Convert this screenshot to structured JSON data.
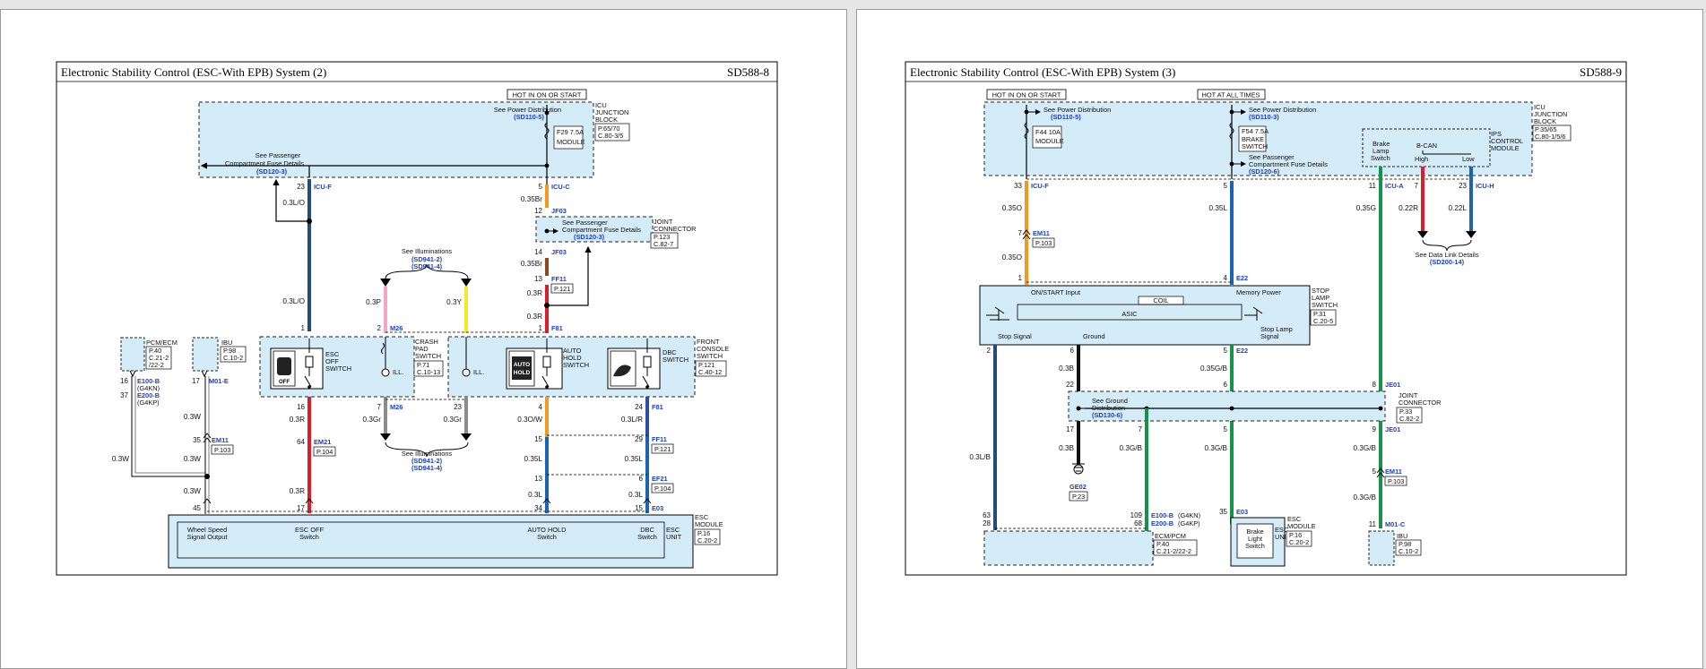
{
  "colors": {
    "box_fill": "#d4ebf8",
    "orange": "#f19a1f",
    "blue": "#1d64b0",
    "red": "#d81e2a",
    "pink": "#f2a7c5",
    "yellow": "#f4e82a",
    "gray": "#8c8c8c",
    "green": "#16924a",
    "dark_blue": "#214d7a",
    "black": "#000000",
    "link_blue": "#1a3ed0"
  },
  "left": {
    "title": "Electronic Stability Control (ESC-With EPB) System (2)",
    "code": "SD588-8",
    "hot": "HOT IN ON OR START",
    "spd": "See Power Distribution",
    "spd_ref": "(SD110-5)",
    "fuse": [
      "F29 7.5A",
      "MODULE"
    ],
    "icu": [
      "ICU",
      "JUNCTION",
      "BLOCK"
    ],
    "icu_ref": [
      "P.65/70",
      "C.80-3/5"
    ],
    "spc": [
      "See Passenger",
      "Compartment Fuse Details"
    ],
    "spc_ref": "(SD120-3)",
    "icu_f": {
      "pin": "23",
      "name": "ICU-F",
      "wire": "0.3L/O"
    },
    "icu_c": {
      "pin": "5",
      "name": "ICU-C",
      "wire": "0.35Br"
    },
    "jf03": {
      "pin1": "12",
      "name": "JF03",
      "pin2": "14",
      "name2": "JF03",
      "wire2": "0.35Br"
    },
    "joint_conn": [
      "JOINT",
      "CONNECTOR"
    ],
    "joint_ref": [
      "P.123",
      "C.82-7"
    ],
    "ff11a": {
      "pin": "13",
      "name": "FF11",
      "ref": "P.121"
    },
    "wire_03r": "0.3R",
    "f81a": {
      "pin": "1",
      "name": "F81"
    },
    "see_illum": "See Illuminations",
    "illum_refs": [
      "(SD941-2)",
      "(SD941-4)"
    ],
    "w_03p": "0.3P",
    "w_03y": "0.3Y",
    "m26a": {
      "pin": "2",
      "name": "M26"
    },
    "crash_pad": [
      "CRASH",
      "PAD",
      "SWITCH"
    ],
    "crash_ref": [
      "P.71",
      "C.10-13"
    ],
    "esc_off_sw": [
      "ESC",
      "OFF",
      "SWITCH"
    ],
    "auto_hold_sw": [
      "AUTO",
      "HOLD",
      "SWITCH"
    ],
    "dbc_sw": [
      "DBC",
      "SWITCH"
    ],
    "front_console": [
      "FRONT",
      "CONSOLE",
      "SWITCH"
    ],
    "front_ref": [
      "P.121",
      "C.40-12"
    ],
    "ill": "ILL.",
    "off_icon": "OFF",
    "auto_hold_icon": [
      "AUTO",
      "HOLD"
    ],
    "pin_1": "1",
    "pin_16": "16",
    "pin_7": "7",
    "m26b": "M26",
    "pin_23": "23",
    "pin_4": "4",
    "pin_24": "24",
    "f81b": "F81",
    "w_03r": "0.3R",
    "w_03gr": "0.3Gr",
    "w_03ow": "0.3O/W",
    "w_03lr": "0.3L/R",
    "em21": {
      "pin": "64",
      "name": "EM21",
      "ref": "P.104"
    },
    "pcm": [
      "PCM/ECM"
    ],
    "pcm_ref": [
      "P.40",
      "C.21-2",
      "/22-2"
    ],
    "ibu": "IBU",
    "ibu_ref": [
      "P.98",
      "C.10-2"
    ],
    "e100": {
      "pin16": "16",
      "name1": "E100-B",
      "sub1": "(G4KN)",
      "pin37": "37",
      "name2": "E200-B",
      "sub2": "(G4KP)"
    },
    "m01e": {
      "pin": "17",
      "name": "M01-E"
    },
    "w_03w": "0.3W",
    "em11": {
      "pin": "35",
      "name": "EM11",
      "ref": "P.103"
    },
    "ff11b": {
      "pin15": "15",
      "pin29": "29",
      "name": "FF11",
      "ref": "P.121"
    },
    "w_035l": "0.35L",
    "w_03l": "0.3L",
    "ef21": {
      "pin13": "13",
      "pin6": "6",
      "name": "EF21",
      "ref": "P.104"
    },
    "e03": {
      "name": "E03"
    },
    "esc_pins": [
      "45",
      "17",
      "34",
      "15"
    ],
    "esc_labels": {
      "wheel": [
        "Wheel Speed",
        "Signal Output"
      ],
      "esc_off": [
        "ESC OFF",
        "Switch"
      ],
      "auto_hold": [
        "AUTO HOLD",
        "Switch"
      ],
      "dbc": [
        "DBC",
        "Switch"
      ]
    },
    "esc_module": [
      "ESC",
      "MODULE"
    ],
    "esc_unit": [
      "ESC",
      "UNIT"
    ],
    "esc_ref": [
      "P.16",
      "C.20-2"
    ]
  },
  "right": {
    "title": "Electronic Stability Control (ESC-With EPB) System (3)",
    "code": "SD588-9",
    "hot1": "HOT IN ON OR START",
    "hot2": "HOT AT ALL TIMES",
    "spd": "See Power Distribution",
    "spd_ref1": "(SD110-5)",
    "spd_ref2": "(SD110-3)",
    "fuse1": [
      "F44 10A",
      "MODULE"
    ],
    "fuse2": [
      "F54 7.5A",
      "BRAKE",
      "SWITCH"
    ],
    "spc": [
      "See Passenger",
      "Compartment Fuse Details"
    ],
    "spc_ref": "(SD120-6)",
    "ips": [
      "IPS",
      "CONTROL",
      "MODULE"
    ],
    "brake_lamp": [
      "Brake",
      "Lamp",
      "Switch"
    ],
    "bcan": "B-CAN",
    "high": "High",
    "low": "Low",
    "icu": [
      "ICU",
      "JUNCTION",
      "BLOCK"
    ],
    "icu_ref": [
      "P.35/65",
      "C.80-1/5/6"
    ],
    "icu_f": {
      "pin": "33",
      "name": "ICU-F",
      "wire": "0.35O"
    },
    "pin_5": "5",
    "w_035l": "0.35L",
    "icu_a": {
      "pin": "11",
      "name": "ICU-A",
      "wire": "0.35G"
    },
    "pin_7": "7",
    "w_022r": "0.22R",
    "icu_h": {
      "pin": "23",
      "name": "ICU-H",
      "wire": "0.22L"
    },
    "em11a": {
      "pin": "7",
      "name": "EM11",
      "ref": "P.103"
    },
    "w_035o": "0.35O",
    "sdl": "See Data Link Details",
    "sdl_ref": "(SD200-14)",
    "e22a": {
      "pin1": "1",
      "pin4": "4",
      "name": "E22"
    },
    "on_start": "ON/START Input",
    "mem_power": "Memory Power",
    "coil": "COIL",
    "asic": "ASIC",
    "stop_lamp_sw": [
      "STOP",
      "LAMP",
      "SWITCH"
    ],
    "stop_lamp_ref": [
      "P.31",
      "C.20-5"
    ],
    "stop_signal": "Stop Signal",
    "ground": "Ground",
    "stop_lamp_signal": [
      "Stop Lamp",
      "Signal"
    ],
    "pin_2": "2",
    "pin_6": "6",
    "pin_5b": "5",
    "e22b": "E22",
    "w_03b": "0.3B",
    "w_035gb": "0.35G/B",
    "je01a": {
      "pin22": "22",
      "pin6": "6",
      "pin8": "8",
      "name": "JE01"
    },
    "sgd": [
      "See Ground",
      "Distribution"
    ],
    "sgd_ref": "(SD130-6)",
    "joint": [
      "JOINT",
      "CONNECTOR"
    ],
    "joint_ref": [
      "P.33",
      "C.82-2"
    ],
    "je01b": {
      "pin17": "17",
      "pin7": "7",
      "pin5": "5",
      "pin9": "9",
      "name": "JE01"
    },
    "w_03gb": "0.3G/B",
    "w_03lb": "0.3L/B",
    "ge02": {
      "name": "GE02",
      "ref": "P.23"
    },
    "em11b": {
      "pin": "5",
      "name": "EM11",
      "ref": "P.103"
    },
    "e100": {
      "pin109": "109",
      "name1": "E100-B",
      "sub1": "(G4KN)",
      "pin68": "68",
      "name2": "E200-B",
      "sub2": "(G4KP)"
    },
    "pins_63_28": [
      "63",
      "28"
    ],
    "ecm_pcm": "ECM/PCM",
    "ecm_ref": [
      "P.40",
      "C.21-2/22-2"
    ],
    "e03": {
      "pin": "35",
      "name": "E03"
    },
    "brake_light_sw": [
      "Brake",
      "Light",
      "Switch"
    ],
    "esc_module": [
      "ESC",
      "MODULE"
    ],
    "esc_unit": [
      "ESC",
      "UNIT"
    ],
    "esc_ref": [
      "P.16",
      "C.20-2"
    ],
    "m01c": {
      "pin": "11",
      "name": "M01-C"
    },
    "ibu": "IBU",
    "ibu_ref": [
      "P.98",
      "C.10-2"
    ]
  }
}
